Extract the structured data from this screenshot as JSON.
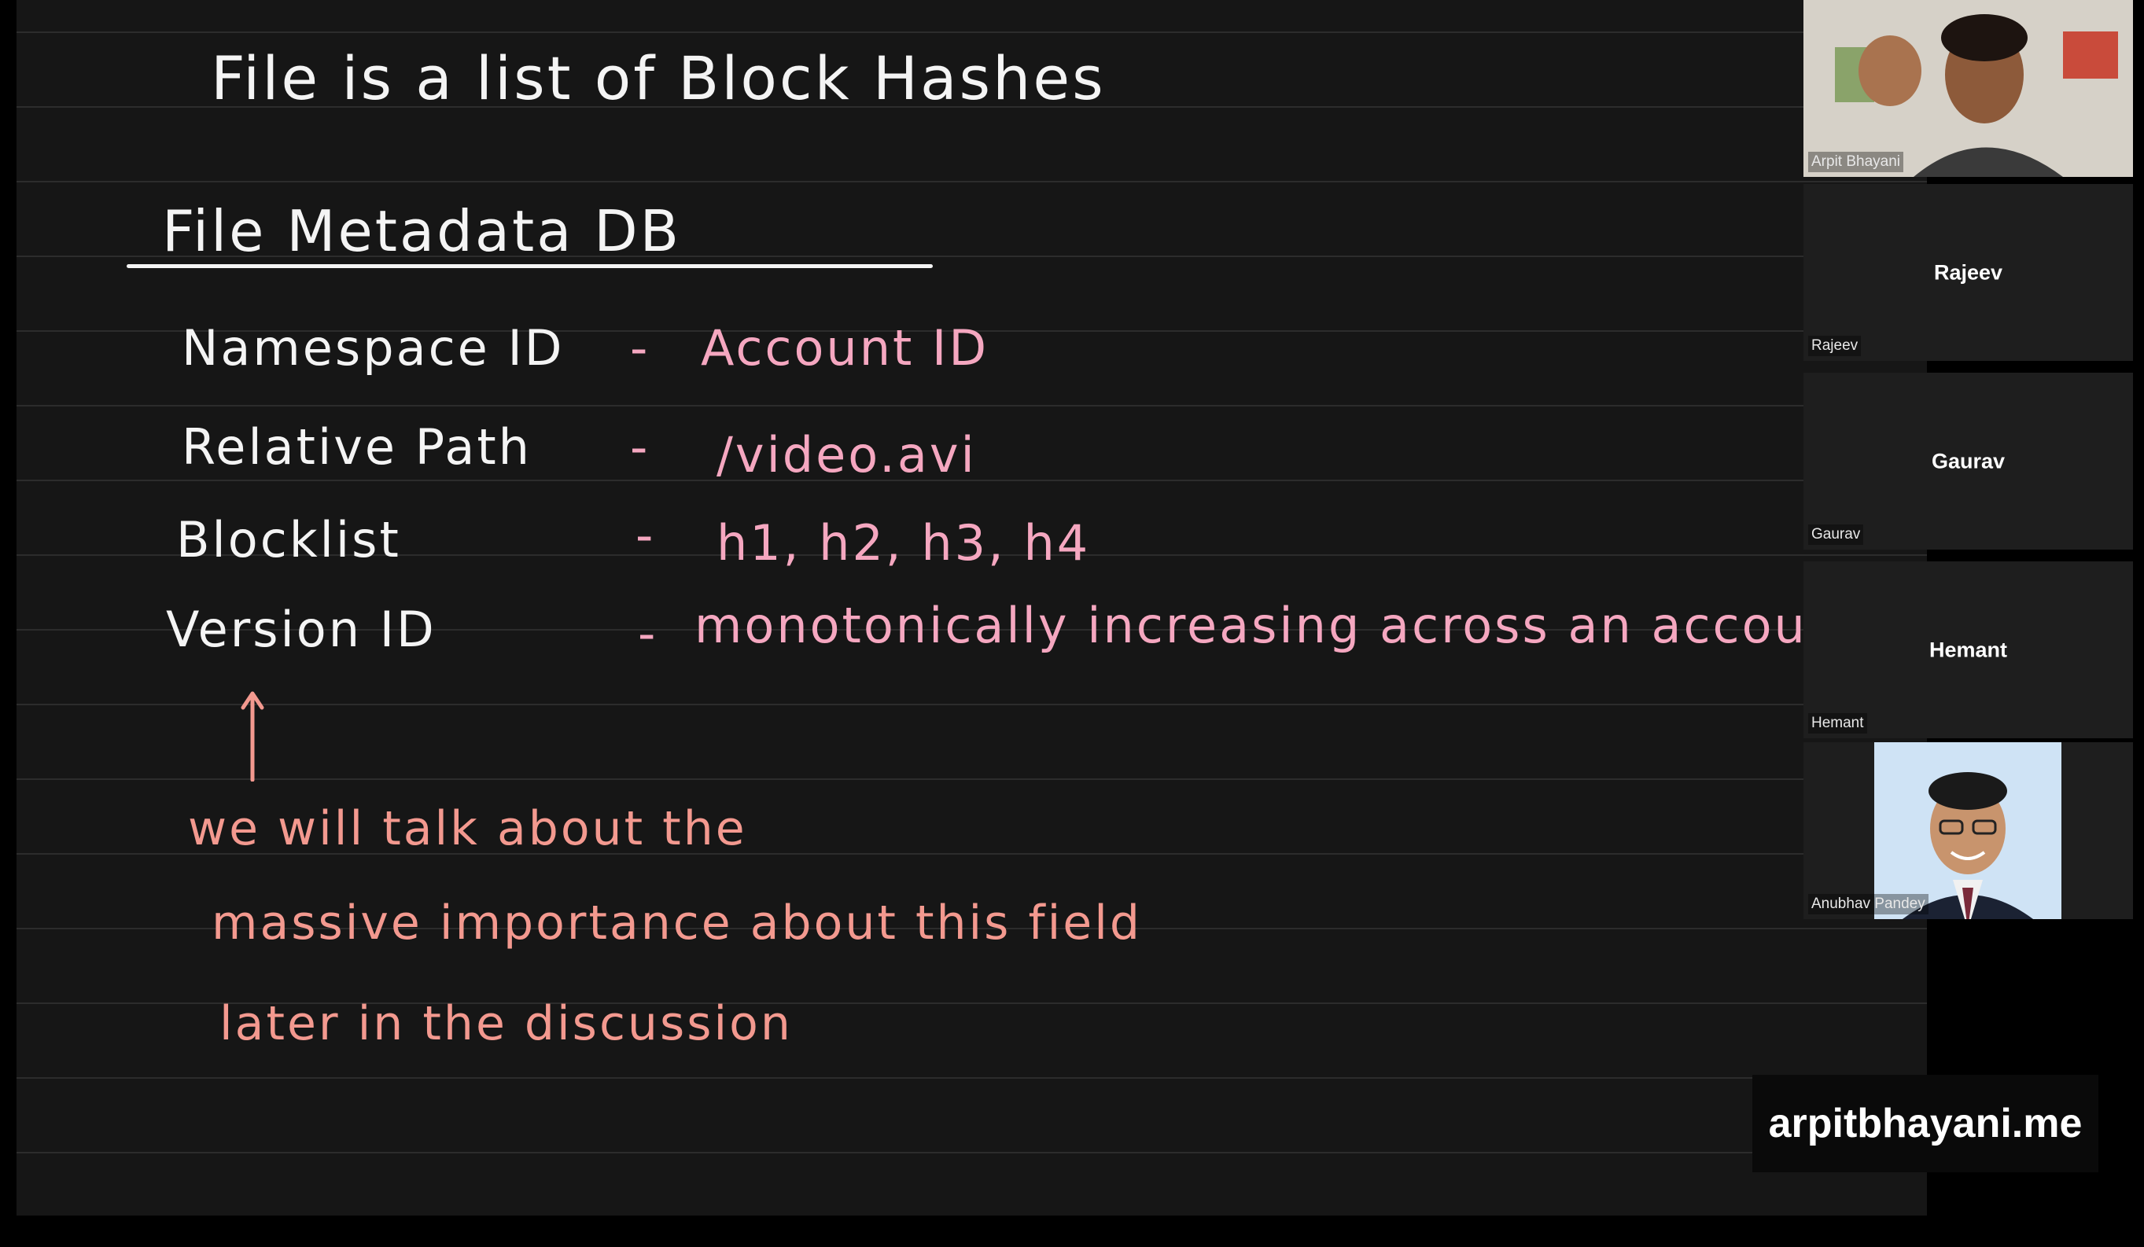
{
  "board": {
    "title": "File is a list of Block Hashes",
    "heading": "File Metadata DB",
    "rows": [
      {
        "label": "Namespace ID",
        "dash": "-",
        "value": "Account ID"
      },
      {
        "label": "Relative Path",
        "dash": "-",
        "value": "/video.avi"
      },
      {
        "label": "Blocklist",
        "dash": "-",
        "value": "h1, h2, h3, h4"
      },
      {
        "label": "Version ID",
        "dash": "-",
        "value": "monotonically increasing across an account"
      }
    ],
    "note": [
      "we will talk about the",
      "massive importance about this field",
      "later in the discussion"
    ],
    "colors": {
      "white": "#f4f4f4",
      "pink": "#f5a7c0",
      "salmon": "#f3998f",
      "background": "#161616"
    }
  },
  "participants": [
    {
      "name": "Arpit Bhayani",
      "center": ""
    },
    {
      "name": "Rajeev",
      "center": "Rajeev"
    },
    {
      "name": "Gaurav",
      "center": "Gaurav"
    },
    {
      "name": "Hemant",
      "center": "Hemant"
    },
    {
      "name": "Anubhav Pandey",
      "center": ""
    }
  ],
  "watermark": "arpitbhayani.me"
}
